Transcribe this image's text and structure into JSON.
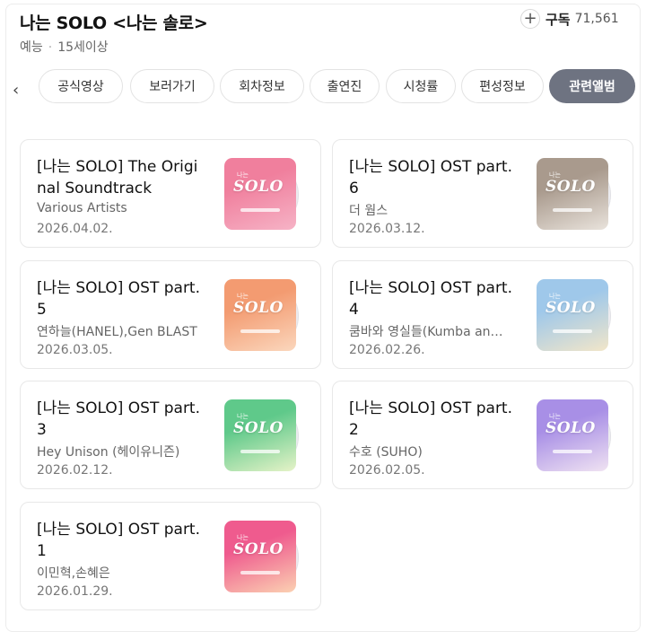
{
  "header": {
    "title": "나는 SOLO <나는 솔로>",
    "genre": "예능",
    "rating": "15세이상",
    "subscribe_label": "구독",
    "subscribe_count": "71,561"
  },
  "tabs": [
    {
      "label": "공식영상",
      "active": false
    },
    {
      "label": "보러가기",
      "active": false
    },
    {
      "label": "회차정보",
      "active": false
    },
    {
      "label": "출연진",
      "active": false
    },
    {
      "label": "시청률",
      "active": false
    },
    {
      "label": "편성정보",
      "active": false
    },
    {
      "label": "관련앨범",
      "active": true
    }
  ],
  "albums": [
    {
      "title": "[나는 SOLO] The Original Soundtrack",
      "artist": "Various Artists",
      "date": "2026.04.02.",
      "cover_colors": [
        "#f07f9d",
        "#f6b3c6"
      ]
    },
    {
      "title": "[나는 SOLO] OST part.6",
      "artist": "더 웜스",
      "date": "2026.03.12.",
      "cover_colors": [
        "#a99a8d",
        "#e9e3dc"
      ]
    },
    {
      "title": "[나는 SOLO] OST part.5",
      "artist": "연하늘(HANEL),Gen BLAST",
      "date": "2026.03.05.",
      "cover_colors": [
        "#f39b71",
        "#fbd7bd"
      ]
    },
    {
      "title": "[나는 SOLO] OST part.4",
      "artist": "쿰바와 영실들(Kumba an…",
      "date": "2026.02.26.",
      "cover_colors": [
        "#9fc8ea",
        "#f2e6c9"
      ]
    },
    {
      "title": "[나는 SOLO] OST part.3",
      "artist": "Hey Unison (헤이유니즌)",
      "date": "2026.02.12.",
      "cover_colors": [
        "#5fc98a",
        "#e6f3c8"
      ]
    },
    {
      "title": "[나는 SOLO] OST part.2",
      "artist": "수호 (SUHO)",
      "date": "2026.02.05.",
      "cover_colors": [
        "#a88fe6",
        "#f0e3f2"
      ]
    },
    {
      "title": "[나는 SOLO] OST part.1",
      "artist": "이민혁,손혜은",
      "date": "2026.01.29.",
      "cover_colors": [
        "#ef5b8e",
        "#fbd1b2"
      ]
    }
  ]
}
